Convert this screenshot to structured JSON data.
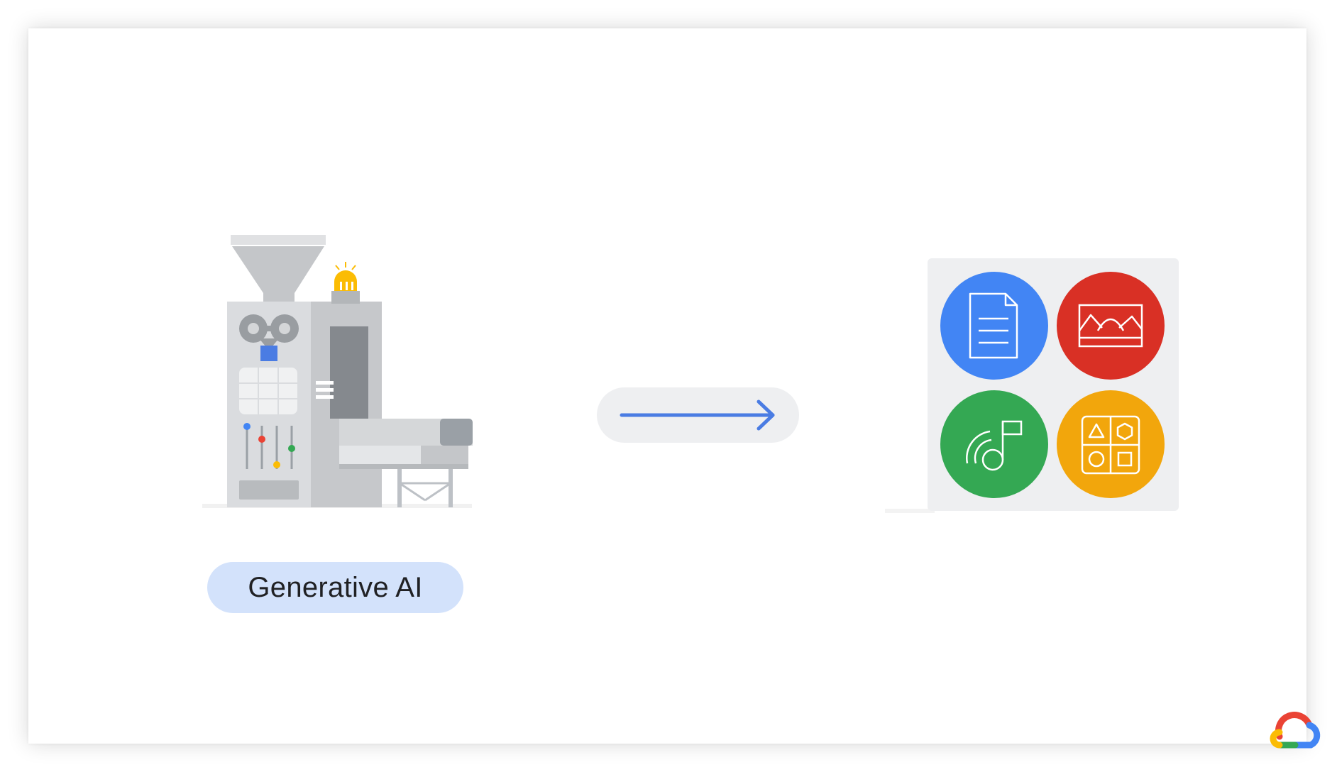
{
  "label": {
    "text": "Generative AI"
  },
  "arrow": {
    "icon": "arrow-right-icon",
    "color": "#4a7ce3",
    "background": "#eeeff1"
  },
  "outputs": {
    "panel_background": "#eeeff1",
    "items": [
      {
        "icon": "document-icon",
        "color": "#4285f4"
      },
      {
        "icon": "image-icon",
        "color": "#d93025"
      },
      {
        "icon": "music-icon",
        "color": "#34a853"
      },
      {
        "icon": "shapes-icon",
        "color": "#f2a60c"
      }
    ]
  },
  "logo": {
    "icon": "google-cloud-logo",
    "colors": [
      "#ea4335",
      "#4285f4",
      "#34a853",
      "#fbbc04"
    ]
  },
  "colors": {
    "pill_background": "#d3e2fb",
    "machine_gray": "#c4c6c9",
    "machine_dark": "#9aa0a6"
  }
}
